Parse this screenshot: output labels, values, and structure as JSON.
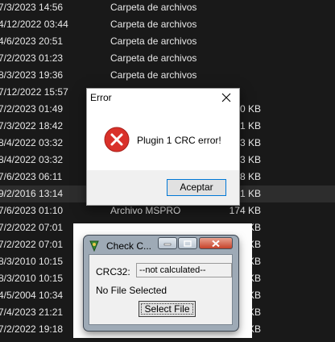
{
  "explorer_rows": [
    {
      "date": "7/3/2023 14:56",
      "type": "Carpeta de archivos",
      "size": ""
    },
    {
      "date": "4/12/2022 03:44",
      "type": "Carpeta de archivos",
      "size": ""
    },
    {
      "date": "4/6/2023 20:51",
      "type": "Carpeta de archivos",
      "size": ""
    },
    {
      "date": "7/2/2023 01:23",
      "type": "Carpeta de archivos",
      "size": ""
    },
    {
      "date": "8/3/2023 19:36",
      "type": "Carpeta de archivos",
      "size": ""
    },
    {
      "date": "7/12/2022 15:57",
      "type": "",
      "size": ""
    },
    {
      "date": "7/2/2023 01:49",
      "type": "",
      "size": "20 KB"
    },
    {
      "date": "7/3/2022 18:42",
      "type": "",
      "size": "1 KB"
    },
    {
      "date": "8/4/2022 03:32",
      "type": "",
      "size": "03 KB"
    },
    {
      "date": "8/4/2022 03:32",
      "type": "",
      "size": "03 KB"
    },
    {
      "date": "7/6/2023 06:11",
      "type": "",
      "size": "48 KB"
    },
    {
      "date": "9/2/2016 13:14",
      "type": "",
      "size": "31 KB"
    },
    {
      "date": "7/6/2023 01:10",
      "type": "Archivo MSPRO",
      "size": "174 KB"
    },
    {
      "date": "7/2/2022 07:01",
      "type": "",
      "size": "KB"
    },
    {
      "date": "7/2/2022 07:01",
      "type": "",
      "size": "KB"
    },
    {
      "date": "8/3/2010 10:15",
      "type": "",
      "size": "KB"
    },
    {
      "date": "8/3/2010 10:15",
      "type": "",
      "size": "KB"
    },
    {
      "date": "4/5/2004 10:34",
      "type": "",
      "size": "KB"
    },
    {
      "date": "7/4/2023 21:21",
      "type": "",
      "size": "KB"
    },
    {
      "date": "7/2/2022 19:18",
      "type": "",
      "size": "KB"
    }
  ],
  "error_dialog": {
    "title": "Error",
    "message": "Plugin 1 CRC error!",
    "ok_label": "Aceptar",
    "icon": "error-icon"
  },
  "crc_window": {
    "title": "Check C...",
    "crc_label": "CRC32:",
    "crc_value": "--not calculated--",
    "status": "No File Selected",
    "button_label": "Select File"
  },
  "colors": {
    "explorer_bg": "#191919",
    "explorer_text": "#e8e8e8",
    "error_red": "#d9312a",
    "ok_border": "#0078d7",
    "close_button": "#c6422a"
  }
}
